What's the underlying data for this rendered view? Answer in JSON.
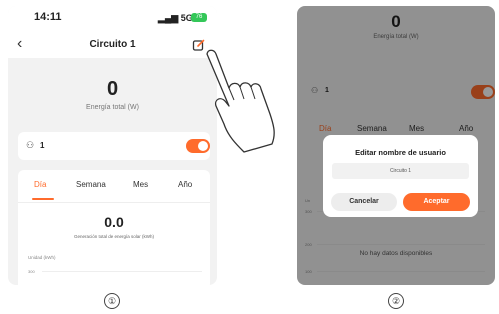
{
  "phone1": {
    "status_time": "14:11",
    "status_signal": "5G",
    "status_battery": "76",
    "nav_title": "Circuito 1",
    "energy_value": "0",
    "energy_label": "Energía total (W)",
    "device_name": "1",
    "tabs": [
      "Día",
      "Semana",
      "Mes",
      "Año"
    ],
    "active_tab": "Día",
    "solar_value": "0.0",
    "solar_label": "Generación total de energía solar (kWh)",
    "unit_label": "Unidad (kWh)",
    "axis_tick": "300",
    "step_marker": "①"
  },
  "phone2": {
    "energy_value": "0",
    "energy_label": "Energía total (W)",
    "device_name": "1",
    "tabs": [
      "Día",
      "Semana",
      "Mes",
      "Año"
    ],
    "active_tab": "Día",
    "axis_ticks": [
      "300",
      "200",
      "100"
    ],
    "axis_unit": "Un",
    "no_data": "No hay datos disponibles",
    "dialog": {
      "title": "Editar nombre de usuario",
      "input_value": "Circuito 1",
      "cancel_label": "Cancelar",
      "accept_label": "Aceptar"
    },
    "step_marker": "②"
  },
  "colors": {
    "accent": "#ff6b2c",
    "toggle_on": "#ff6b2c",
    "battery": "#34c759"
  },
  "icons": [
    "back-chevron-icon",
    "edit-icon",
    "device-icon",
    "toggle-switch-icon",
    "hand-pointer-icon"
  ]
}
